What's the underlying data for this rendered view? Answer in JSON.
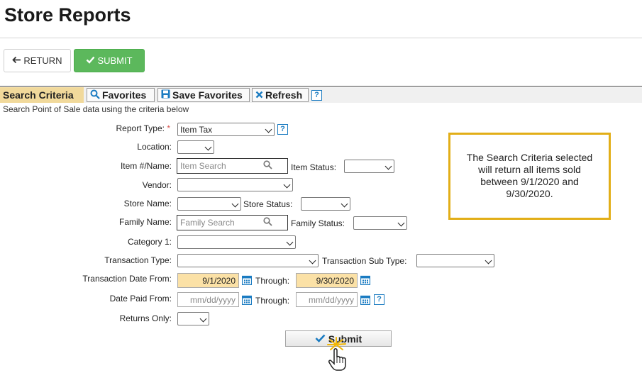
{
  "page": {
    "title": "Store Reports"
  },
  "top_buttons": {
    "return_label": "RETURN",
    "submit_label": "SUBMIT"
  },
  "toolbar": {
    "section_label": "Search Criteria",
    "favorites_label": "Favorites",
    "save_favorites_label": "Save Favorites",
    "refresh_label": "Refresh",
    "help_glyph": "?"
  },
  "subtitle": "Search Point of Sale data using the criteria below",
  "form": {
    "report_type": {
      "label": "Report Type:",
      "required_mark": "*",
      "value": "Item Tax"
    },
    "location": {
      "label": "Location:",
      "value": ""
    },
    "item_name": {
      "label": "Item #/Name:",
      "placeholder": "Item Search"
    },
    "item_status": {
      "label": "Item Status:",
      "value": ""
    },
    "vendor": {
      "label": "Vendor:",
      "value": ""
    },
    "store_name": {
      "label": "Store Name:",
      "value": ""
    },
    "store_status": {
      "label": "Store Status:",
      "value": ""
    },
    "family_name": {
      "label": "Family Name:",
      "placeholder": "Family Search"
    },
    "family_status": {
      "label": "Family Status:",
      "value": ""
    },
    "category_1": {
      "label": "Category 1:",
      "value": ""
    },
    "transaction_type": {
      "label": "Transaction Type:",
      "value": ""
    },
    "transaction_sub_type": {
      "label": "Transaction Sub Type:",
      "value": ""
    },
    "transaction_date_from": {
      "label": "Transaction Date From:",
      "value": "9/1/2020"
    },
    "transaction_date_through": {
      "label": "Through:",
      "value": "9/30/2020"
    },
    "date_paid_from": {
      "label": "Date Paid From:",
      "placeholder": "mm/dd/yyyy"
    },
    "date_paid_through": {
      "label": "Through:",
      "placeholder": "mm/dd/yyyy"
    },
    "returns_only": {
      "label": "Returns Only:",
      "value": ""
    },
    "submit_label": "Submit"
  },
  "callout": {
    "text": "The Search Criteria selected will return all items sold between 9/1/2020 and 9/30/2020."
  },
  "colors": {
    "accent_green": "#5cb85c",
    "callout_border": "#e2ae18",
    "date_highlight": "#fbe1a6",
    "help_blue": "#1a7bc1",
    "section_tab": "#f1d99b"
  },
  "icons": [
    "arrow-left-icon",
    "check-icon",
    "search-icon",
    "save-icon",
    "close-icon",
    "help-icon",
    "calendar-icon",
    "hand-pointer-icon"
  ]
}
